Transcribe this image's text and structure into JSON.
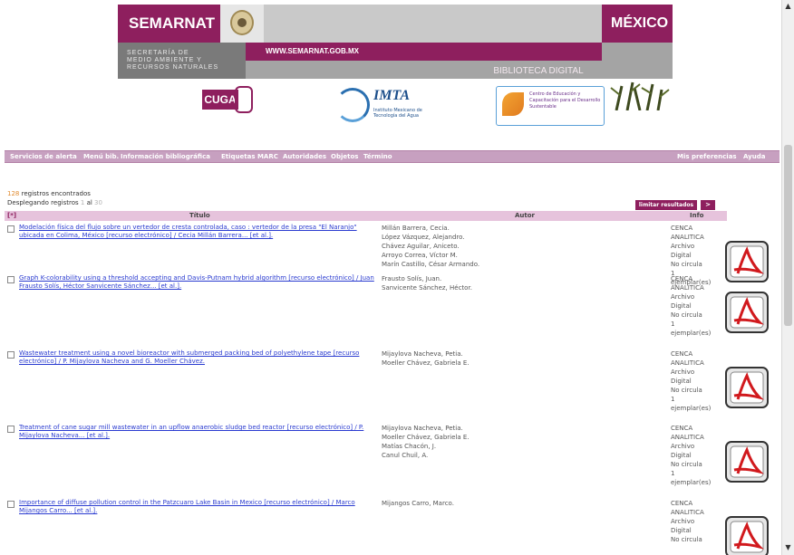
{
  "banner": {
    "semarnat": "SEMARNAT",
    "mexico": "MÉXICO",
    "secretaria": [
      "SECRETARÍA DE",
      "MEDIO AMBIENTE Y",
      "RECURSOS NATURALES"
    ],
    "website": "WWW.SEMARNAT.GOB.MX",
    "biblioteca": "BIBLIOTECA DIGITAL",
    "cuga_logo": "CUGA",
    "imta_logo": "IMTA",
    "imta_sub": "Instituto Mexicano de Tecnología del Agua",
    "cecadesu_sub": "Centro de Educación y Capacitación para el Desarrollo Sustentable"
  },
  "menu": {
    "items": [
      "Servicios de alerta",
      "Menú bib.",
      "Información bibliográfica",
      "Etiquetas MARC",
      "Autoridades",
      "Objetos",
      "Término"
    ],
    "right_items": [
      "Mis preferencias",
      "Ayuda"
    ]
  },
  "results": {
    "count": "128",
    "found_label": "registros encontrados",
    "showing_label": "Desplegando registros",
    "range_start": "1",
    "of_label": "al",
    "range_end": "30",
    "limit_button": "limitar resultados",
    "next_button": ">"
  },
  "table": {
    "sort_icon_label": "[*]",
    "headers": {
      "title": "Título",
      "author": "Autor",
      "info": "Info"
    },
    "rows": [
      {
        "title": "Modelación física del flujo sobre un vertedor de cresta controlada, caso : vertedor de la presa \"El Naranjo\" ubicada en Colima, México [recurso electrónico] / Cecia Millán Barrera... [et al.].",
        "author": "Millán Barrera, Cecia.\nLópez Vázquez, Alejandro.\nChávez Aguilar, Aniceto.\nArroyo Correa, Víctor M.\nMarín Castillo, César Armando.",
        "info": "CENCA\nANALITICA\nArchivo\nDigital\nNo circula\n1\nejemplar(es)"
      },
      {
        "title": "Graph K-colorability using a threshold accepting and Davis-Putnam hybrid algorithm [recurso electrónico] / Juan Frausto Solís, Héctor Sanvicente Sánchez... [et al.].",
        "author": "Frausto Solís, Juan.\nSanvicente Sánchez, Héctor.",
        "info": "CENCA\nANALITICA\nArchivo\nDigital\nNo circula\n1\nejemplar(es)"
      },
      {
        "title": "Wastewater treatment using a novel bioreactor with submerged packing bed of polyethylene tape [recurso electrónico] / P. Mijaylova Nacheva and G. Moeller Chávez.",
        "author": "Mijaylova Nacheva, Petia.\nMoeller Chávez, Gabriela E.",
        "info": "CENCA\nANALITICA\nArchivo\nDigital\nNo circula\n1\nejemplar(es)"
      },
      {
        "title": "Treatment of cane sugar mill wastewater in an upflow anaerobic sludge bed reactor [recurso electrónico] / P. Mijaylova Nacheva... [et al.].",
        "author": "Mijaylova Nacheva, Petia.\nMoeller Chávez, Gabriela E.\nMatías Chacón, J.\nCanul Chuil, A.",
        "info": "CENCA\nANALITICA\nArchivo\nDigital\nNo circula\n1\nejemplar(es)"
      },
      {
        "title": "Importance of diffuse pollution control in the Patzcuaro Lake Basin in Mexico [recurso electrónico] / Marco Mijangos Carro... [et al.].",
        "author": "Mijangos Carro, Marco.",
        "info": "CENCA\nANALITICA\nArchivo\nDigital\nNo circula"
      }
    ]
  },
  "colors": {
    "brand": "#8e1f5e",
    "menu_bg": "#c7a0c0",
    "header_bg": "#e6c3dc",
    "link": "#2a3bd0"
  }
}
